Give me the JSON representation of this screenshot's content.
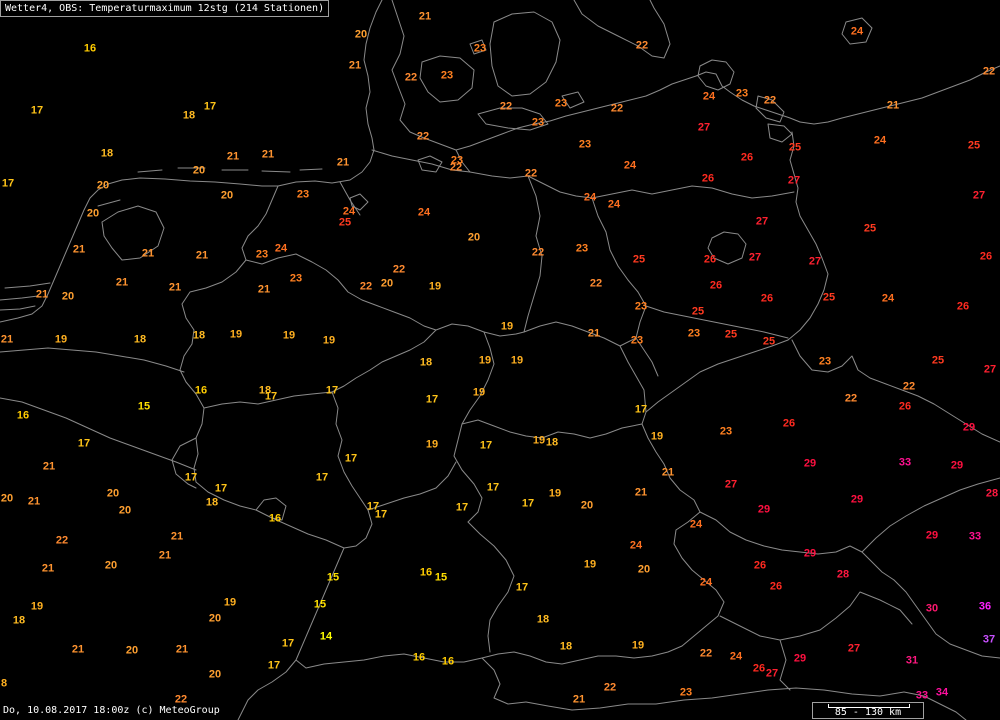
{
  "title": "Wetter4, OBS: Temperaturmaximum 12stg (214 Stationen)",
  "footer": "Do, 10.08.2017 18:00z (c) MeteoGroup",
  "scale_label": "85 - 130 km",
  "temperature_colors": {
    "8": "#ffb020",
    "14": "#ffff00",
    "15": "#ffe000",
    "16": "#ffcc00",
    "17": "#ffc418",
    "18": "#ffbb22",
    "19": "#ffb020",
    "20": "#ffa030",
    "21": "#ff9430",
    "22": "#ff8a30",
    "23": "#ff8020",
    "24": "#ff7020",
    "25": "#ff3a20",
    "26": "#ff2a20",
    "27": "#ff2030",
    "28": "#ff1840",
    "29": "#ff1040",
    "30": "#ff1870",
    "31": "#ff1880",
    "33": "#ff1090",
    "34": "#ff10a0",
    "36": "#ff20ff",
    "37": "#c850ff"
  },
  "station_values": [
    21,
    20,
    16,
    23,
    22,
    24,
    21,
    22,
    23,
    22,
    17,
    17,
    18,
    22,
    23,
    22,
    24,
    23,
    22,
    21,
    23,
    27,
    22,
    23,
    24,
    25,
    25,
    18,
    21,
    21,
    21,
    23,
    22,
    26,
    24,
    20,
    22,
    17,
    20,
    26,
    27,
    20,
    23,
    24,
    24,
    27,
    20,
    24,
    25,
    24,
    27,
    25,
    20,
    21,
    21,
    21,
    23,
    24,
    22,
    23,
    25,
    26,
    27,
    27,
    26,
    22,
    23,
    21,
    21,
    21,
    22,
    20,
    19,
    22,
    26,
    21,
    20,
    26,
    25,
    24,
    26,
    23,
    25,
    19,
    21,
    23,
    25,
    25,
    23,
    21,
    19,
    18,
    18,
    19,
    19,
    19,
    18,
    19,
    19,
    23,
    25,
    27,
    22,
    22,
    16,
    18,
    17,
    17,
    19,
    17,
    15,
    26,
    16,
    17,
    26,
    29,
    23,
    19,
    19,
    18,
    17,
    19,
    17,
    17,
    29,
    33,
    29,
    21,
    21,
    17,
    17,
    27,
    17,
    17,
    21,
    20,
    19,
    28,
    20,
    21,
    29,
    18,
    17,
    20,
    17,
    17,
    29,
    20,
    17,
    16,
    24,
    29,
    33,
    21,
    22,
    24,
    29,
    21,
    19,
    26,
    20,
    21,
    20,
    16,
    28,
    15,
    15,
    24,
    26,
    17,
    19,
    15,
    19,
    36,
    30,
    20,
    18,
    18,
    14,
    37,
    17,
    18,
    19,
    27,
    21,
    20,
    21,
    22,
    24,
    16,
    29,
    31,
    16,
    17,
    26,
    27,
    20,
    8,
    22,
    23,
    34,
    33,
    22,
    21
  ]
}
